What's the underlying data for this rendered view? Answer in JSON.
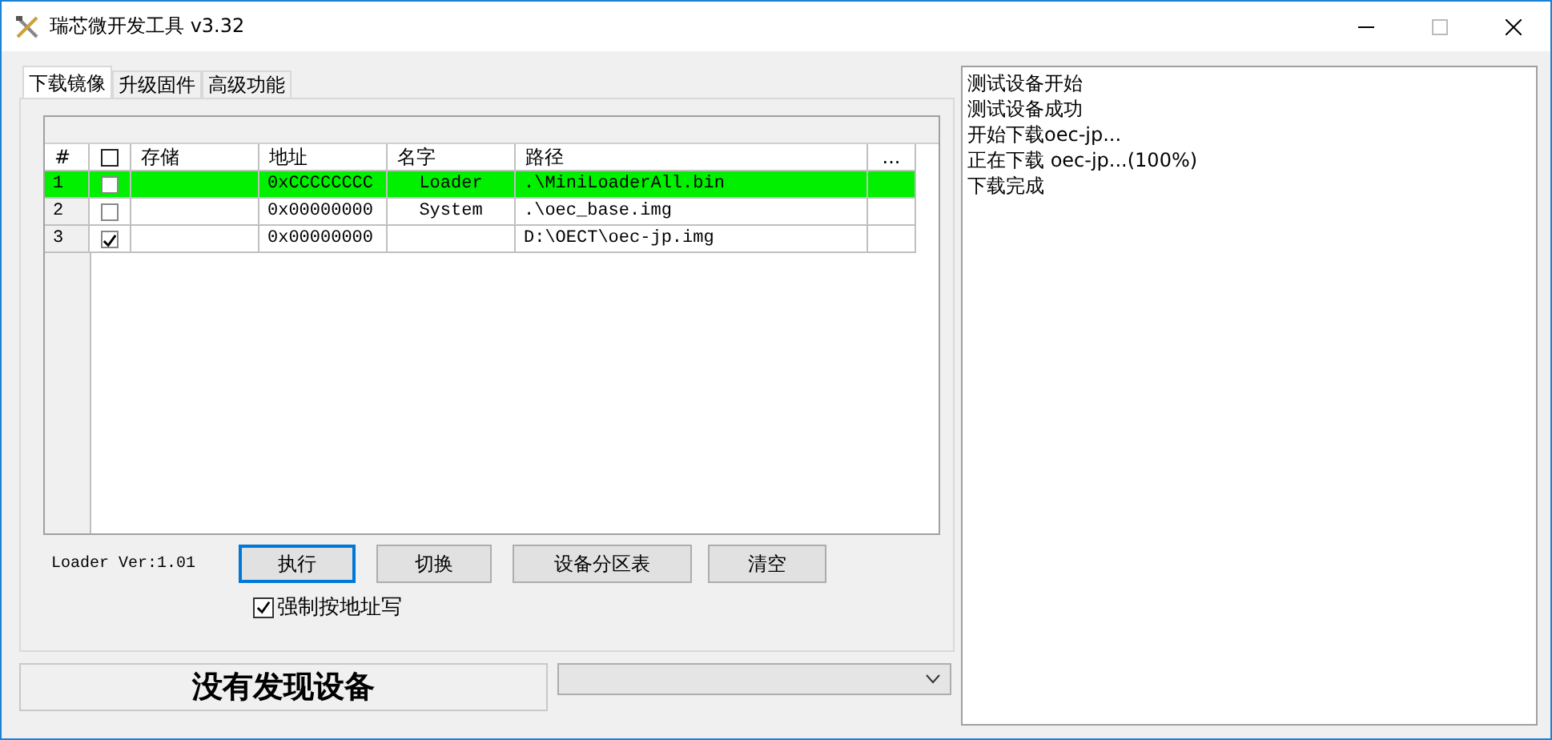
{
  "window": {
    "title": "瑞芯微开发工具 v3.32"
  },
  "tabs": [
    {
      "label": "下载镜像",
      "selected": true
    },
    {
      "label": "升级固件",
      "selected": false
    },
    {
      "label": "高级功能",
      "selected": false
    }
  ],
  "table": {
    "columns": [
      "#",
      "存储",
      "地址",
      "名字",
      "路径",
      "..."
    ],
    "header_checkbox": {
      "checked": false
    },
    "rows": [
      {
        "number": "1",
        "checked": false,
        "selected": true,
        "address": "0xCCCCCCCC",
        "name": "Loader",
        "path": ".\\MiniLoaderAll.bin"
      },
      {
        "number": "2",
        "checked": false,
        "selected": false,
        "address": "0x00000000",
        "name": "System",
        "path": ".\\oec_base.img"
      },
      {
        "number": "3",
        "checked": true,
        "selected": false,
        "address": "0x00000000",
        "path": "D:\\OECT\\oec-jp.img"
      }
    ]
  },
  "loader_version": "Loader Ver:1.01",
  "buttons": [
    {
      "label": "执行",
      "focused": true
    },
    {
      "label": "切换",
      "focused": false
    },
    {
      "label": "设备分区表",
      "focused": false
    },
    {
      "label": "清空",
      "focused": false
    }
  ],
  "force_address_write": {
    "label": "强制按地址写",
    "checked": true
  },
  "status": "没有发现设备",
  "log": [
    "测试设备开始",
    "测试设备成功",
    "开始下载oec-jp...",
    "正在下载 oec-jp...(100%)",
    "下载完成"
  ]
}
